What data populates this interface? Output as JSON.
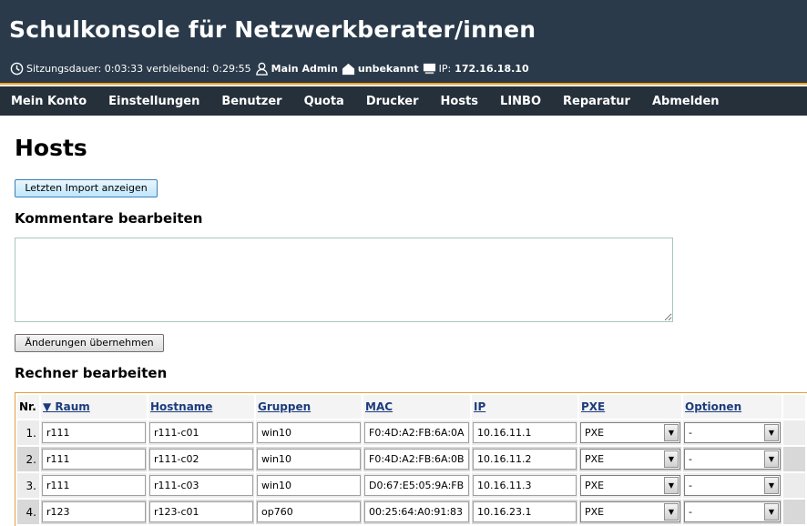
{
  "header": {
    "title": "Schulkonsole für Netzwerkberater/innen",
    "session_label": "Sitzungsdauer: 0:03:33 verbleibend: 0:29:55",
    "user": "Main Admin",
    "room": "unbekannt",
    "ip_label": "IP:",
    "ip": "172.16.18.10"
  },
  "nav": {
    "items": [
      "Mein Konto",
      "Einstellungen",
      "Benutzer",
      "Quota",
      "Drucker",
      "Hosts",
      "LINBO",
      "Reparatur",
      "Abmelden"
    ]
  },
  "page": {
    "title": "Hosts",
    "import_button": "Letzten Import anzeigen",
    "comments_heading": "Kommentare bearbeiten",
    "comment_value": "",
    "apply_button": "Änderungen übernehmen",
    "computers_heading": "Rechner bearbeiten"
  },
  "table": {
    "headers": {
      "nr": "Nr.",
      "room": "▼ Raum",
      "hostname": "Hostname",
      "groups": "Gruppen",
      "mac": "MAC",
      "ip": "IP",
      "pxe": "PXE",
      "options": "Optionen"
    },
    "rows": [
      {
        "nr": "1.",
        "room": "r111",
        "hostname": "r111-c01",
        "group": "win10",
        "mac": "F0:4D:A2:FB:6A:0A",
        "ip": "10.16.11.1",
        "pxe": "PXE",
        "option": "-"
      },
      {
        "nr": "2.",
        "room": "r111",
        "hostname": "r111-c02",
        "group": "win10",
        "mac": "F0:4D:A2:FB:6A:0B",
        "ip": "10.16.11.2",
        "pxe": "PXE",
        "option": "-"
      },
      {
        "nr": "3.",
        "room": "r111",
        "hostname": "r111-c03",
        "group": "win10",
        "mac": "D0:67:E5:05:9A:FB",
        "ip": "10.16.11.3",
        "pxe": "PXE",
        "option": "-"
      },
      {
        "nr": "4.",
        "room": "r123",
        "hostname": "r123-c01",
        "group": "op760",
        "mac": "00:25:64:A0:91:83",
        "ip": "10.16.23.1",
        "pxe": "PXE",
        "option": "-"
      }
    ]
  },
  "colors": {
    "header_bg": "#2a3a4a",
    "nav_bg": "#26303a",
    "accent": "#f0a020",
    "link": "#1c3c7c"
  },
  "icons": [
    "clock-icon",
    "user-icon",
    "house-icon",
    "monitor-icon",
    "chevron-down-icon",
    "sort-desc-icon"
  ]
}
